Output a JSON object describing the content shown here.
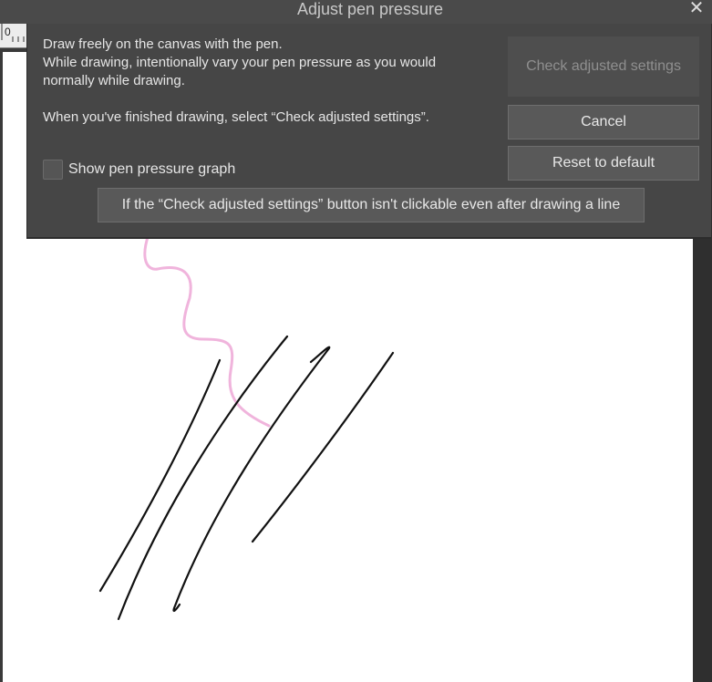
{
  "window": {
    "title": "Adjust pen pressure",
    "close_glyph": "✕"
  },
  "ruler": {
    "zero": "0"
  },
  "dialog": {
    "instructions": [
      "Draw freely on the canvas with the pen.",
      "While drawing, intentionally vary your pen pressure as you would normally while drawing.",
      "When you've finished drawing, select “Check adjusted settings”."
    ],
    "check_button": {
      "label": "Check adjusted settings",
      "enabled": false
    },
    "cancel_button": {
      "label": "Cancel"
    },
    "reset_button": {
      "label": "Reset to default"
    },
    "show_graph": {
      "label": "Show pen pressure graph",
      "checked": false
    },
    "help_button": {
      "label": "If the “Check adjusted settings” button isn't clickable even after drawing a line"
    }
  },
  "colors": {
    "stroke_black": "#111111",
    "stroke_pink": "#f0b4dc",
    "dialog_bg": "#464646",
    "button_bg": "#595959"
  }
}
